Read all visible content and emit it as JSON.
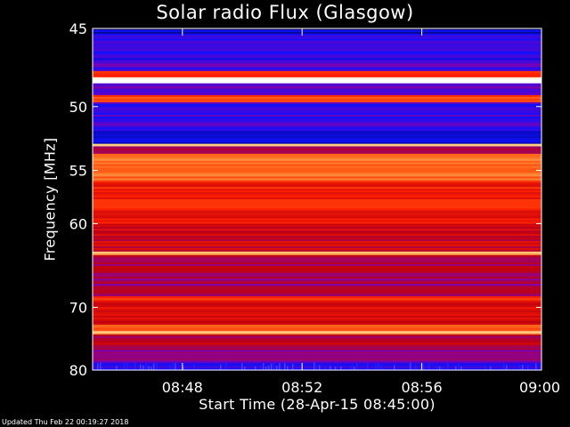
{
  "chart_data": {
    "type": "heatmap",
    "title": "Solar radio Flux (Glasgow)",
    "xlabel": "Start Time (28-Apr-15 08:45:00)",
    "ylabel": "Frequency [MHz]",
    "x_ticks": [
      "08:48",
      "08:52",
      "08:56",
      "09:00"
    ],
    "y_ticks": [
      "45",
      "50",
      "55",
      "60",
      "70",
      "80"
    ],
    "y_scale": "reciprocal",
    "xlim": [
      "08:45:00",
      "09:00:00"
    ],
    "ylim": [
      45,
      80
    ],
    "colormap": [
      "#000060",
      "#1010ff",
      "#8000b0",
      "#c00010",
      "#ff2000",
      "#ff7020",
      "#ffd080",
      "#ffffff"
    ],
    "bands": [
      {
        "f_from": 45.0,
        "f_to": 45.3,
        "level": 0.08
      },
      {
        "f_from": 45.3,
        "f_to": 47.0,
        "level": 0.18
      },
      {
        "f_from": 47.0,
        "f_to": 47.6,
        "level": 0.22
      },
      {
        "f_from": 47.6,
        "f_to": 48.0,
        "level": 0.55
      },
      {
        "f_from": 48.0,
        "f_to": 48.4,
        "level": 0.95
      },
      {
        "f_from": 48.4,
        "f_to": 49.2,
        "level": 0.25
      },
      {
        "f_from": 49.2,
        "f_to": 49.7,
        "level": 0.62
      },
      {
        "f_from": 49.7,
        "f_to": 51.8,
        "level": 0.2
      },
      {
        "f_from": 51.8,
        "f_to": 52.8,
        "level": 0.12
      },
      {
        "f_from": 52.8,
        "f_to": 53.0,
        "level": 0.8
      },
      {
        "f_from": 53.0,
        "f_to": 53.6,
        "level": 0.35
      },
      {
        "f_from": 53.6,
        "f_to": 56.0,
        "level": 0.7
      },
      {
        "f_from": 56.0,
        "f_to": 60.0,
        "level": 0.55
      },
      {
        "f_from": 60.0,
        "f_to": 63.0,
        "level": 0.45
      },
      {
        "f_from": 63.0,
        "f_to": 63.4,
        "level": 0.78
      },
      {
        "f_from": 63.4,
        "f_to": 66.0,
        "level": 0.4
      },
      {
        "f_from": 66.0,
        "f_to": 68.5,
        "level": 0.35
      },
      {
        "f_from": 68.5,
        "f_to": 69.0,
        "level": 0.6
      },
      {
        "f_from": 69.0,
        "f_to": 72.5,
        "level": 0.48
      },
      {
        "f_from": 72.5,
        "f_to": 73.5,
        "level": 0.62
      },
      {
        "f_from": 73.5,
        "f_to": 74.0,
        "level": 0.82
      },
      {
        "f_from": 74.0,
        "f_to": 76.5,
        "level": 0.4
      },
      {
        "f_from": 76.5,
        "f_to": 78.5,
        "level": 0.32
      },
      {
        "f_from": 78.5,
        "f_to": 80.0,
        "level": 0.2
      }
    ]
  },
  "footer": "Updated Thu Feb 22 00:19:27 2018"
}
